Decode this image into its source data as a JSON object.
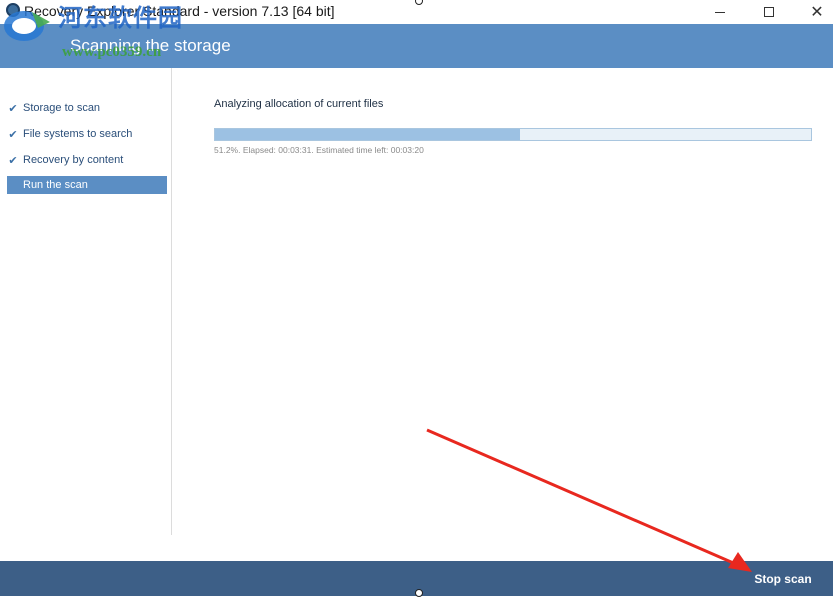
{
  "window": {
    "title": "Recovery Explorer Standard - version 7.13 [64 bit]",
    "minimize_icon": "minimize-icon",
    "maximize_icon": "maximize-icon",
    "close_icon": "close-icon",
    "close_glyph": "✕"
  },
  "watermark": {
    "text": "河东软件园",
    "url": "www.pc0359.cn"
  },
  "header": {
    "title": "Scanning the storage"
  },
  "steps": [
    {
      "label": "Storage to scan",
      "done": true,
      "check": "✔"
    },
    {
      "label": "File systems to search",
      "done": true,
      "check": "✔"
    },
    {
      "label": "Recovery by content",
      "done": true,
      "check": "✔"
    },
    {
      "label": "Run the scan",
      "done": false,
      "active": true
    }
  ],
  "main": {
    "title": "Analyzing allocation of current files",
    "progress_fraction": 0.512,
    "status": "51.2%. Elapsed: 00:03:31. Estimated time left: 00:03:20"
  },
  "footer": {
    "stop_label": "Stop scan"
  },
  "colors": {
    "header": "#5b8ec4",
    "footer": "#3d5f87",
    "progress_fill": "#9cc1e3",
    "annotation_arrow": "#e8281f"
  }
}
